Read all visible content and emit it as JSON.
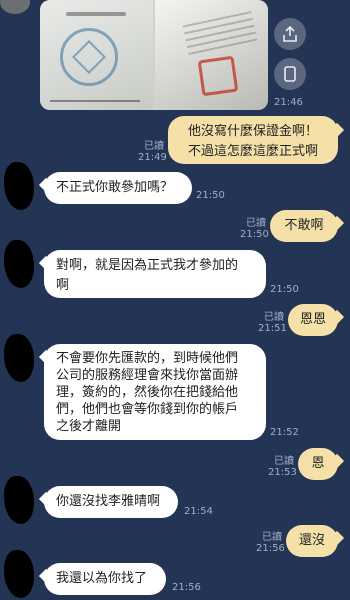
{
  "photos": {
    "side_buttons": [
      "share-icon",
      "save-icon"
    ],
    "time": "21:46"
  },
  "messages": [
    {
      "dir": "out",
      "text": "他沒寫什麼保證金啊！\n不過這怎麼這麼正式啊",
      "read": "已讀",
      "time": "21:49"
    },
    {
      "dir": "in",
      "text": "不正式你敢參加嗎？",
      "time": "21:50"
    },
    {
      "dir": "out",
      "text": "不敢啊",
      "read": "已讀",
      "time": "21:50"
    },
    {
      "dir": "in",
      "text": "對啊，就是因為正式我才參加的\n啊",
      "time": "21:50"
    },
    {
      "dir": "out",
      "text": "恩恩",
      "read": "已讀",
      "time": "21:51"
    },
    {
      "dir": "in",
      "text": "不會要你先匯款的，到時候他們\n公司的服務經理會來找你當面辦\n理，簽約的，然後你在把錢給他\n們，他們也會等你錢到你的帳戶\n之後才離開",
      "time": "21:52"
    },
    {
      "dir": "out",
      "text": "恩",
      "read": "已讀",
      "time": "21:53"
    },
    {
      "dir": "in",
      "text": "你還沒找李雅晴啊",
      "time": "21:54"
    },
    {
      "dir": "out",
      "text": "還沒",
      "read": "已讀",
      "time": "21:56"
    },
    {
      "dir": "in",
      "text": "我還以為你找了",
      "time": "21:56"
    }
  ],
  "colors": {
    "background": "#243454",
    "incoming_bubble": "#ffffff",
    "outgoing_bubble": "#f5e1a8",
    "meta_text": "#9faec8"
  }
}
